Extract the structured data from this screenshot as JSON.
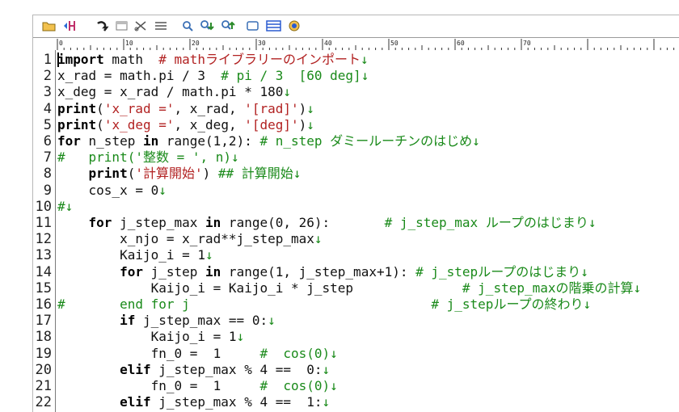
{
  "toolbar": {
    "icons": [
      "open-folder-icon",
      "bookmark-icon",
      "wrap-icon",
      "window-icon",
      "cut-icon",
      "list-icon",
      "search-icon",
      "search-next-icon",
      "search-prev-icon",
      "box-icon",
      "grid-icon",
      "help-icon"
    ]
  },
  "ruler": {
    "marks": [
      "0",
      "10",
      "20",
      "30",
      "40",
      "50",
      "60",
      "70"
    ]
  },
  "lines": [
    {
      "n": "1",
      "segs": [
        {
          "t": "import",
          "c": "kw"
        },
        {
          "t": " math  "
        },
        {
          "t": "# mathライブラリーのインポート",
          "c": "str"
        },
        {
          "t": "↓",
          "c": "eol"
        }
      ]
    },
    {
      "n": "2",
      "segs": [
        {
          "t": "x_rad = math.pi / 3  "
        },
        {
          "t": "# pi / 3  [60 deg]",
          "c": "cm"
        },
        {
          "t": "↓",
          "c": "eol"
        }
      ]
    },
    {
      "n": "3",
      "segs": [
        {
          "t": "x_deg = x_rad / math.pi * 180"
        },
        {
          "t": "↓",
          "c": "eol"
        }
      ]
    },
    {
      "n": "4",
      "segs": [
        {
          "t": "print",
          "c": "kw"
        },
        {
          "t": "("
        },
        {
          "t": "'x_rad ='",
          "c": "str"
        },
        {
          "t": ", x_rad, "
        },
        {
          "t": "'[rad]'",
          "c": "str"
        },
        {
          "t": ")"
        },
        {
          "t": "↓",
          "c": "eol"
        }
      ]
    },
    {
      "n": "5",
      "segs": [
        {
          "t": "print",
          "c": "kw"
        },
        {
          "t": "("
        },
        {
          "t": "'x_deg ='",
          "c": "str"
        },
        {
          "t": ", x_deg, "
        },
        {
          "t": "'[deg]'",
          "c": "str"
        },
        {
          "t": ")"
        },
        {
          "t": "↓",
          "c": "eol"
        }
      ]
    },
    {
      "n": "6",
      "segs": [
        {
          "t": "for",
          "c": "kw"
        },
        {
          "t": " n_step "
        },
        {
          "t": "in",
          "c": "kw"
        },
        {
          "t": " range(1,2): "
        },
        {
          "t": "# n_step ダミールーチンのはじめ",
          "c": "cm"
        },
        {
          "t": "↓",
          "c": "eol"
        }
      ]
    },
    {
      "n": "7",
      "segs": [
        {
          "t": "#   print('整数 = ', n)",
          "c": "cm"
        },
        {
          "t": "↓",
          "c": "eol"
        }
      ]
    },
    {
      "n": "8",
      "segs": [
        {
          "t": "    "
        },
        {
          "t": "print",
          "c": "kw"
        },
        {
          "t": "("
        },
        {
          "t": "'計算開始'",
          "c": "str"
        },
        {
          "t": ") "
        },
        {
          "t": "## 計算開始",
          "c": "cm"
        },
        {
          "t": "↓",
          "c": "eol"
        }
      ]
    },
    {
      "n": "9",
      "segs": [
        {
          "t": "    cos_x = 0"
        },
        {
          "t": "↓",
          "c": "eol"
        }
      ]
    },
    {
      "n": "10",
      "segs": [
        {
          "t": "#",
          "c": "cm"
        },
        {
          "t": "↓",
          "c": "eol"
        }
      ]
    },
    {
      "n": "11",
      "segs": [
        {
          "t": "    "
        },
        {
          "t": "for",
          "c": "kw"
        },
        {
          "t": " j_step_max "
        },
        {
          "t": "in",
          "c": "kw"
        },
        {
          "t": " range(0, 26):       "
        },
        {
          "t": "# j_step_max ループのはじまり",
          "c": "cm"
        },
        {
          "t": "↓",
          "c": "eol"
        }
      ]
    },
    {
      "n": "12",
      "segs": [
        {
          "t": "        x_njo = x_rad**j_step_max"
        },
        {
          "t": "↓",
          "c": "eol"
        }
      ]
    },
    {
      "n": "13",
      "segs": [
        {
          "t": "        Kaijo_i = 1"
        },
        {
          "t": "↓",
          "c": "eol"
        }
      ]
    },
    {
      "n": "14",
      "segs": [
        {
          "t": "        "
        },
        {
          "t": "for",
          "c": "kw"
        },
        {
          "t": " j_step "
        },
        {
          "t": "in",
          "c": "kw"
        },
        {
          "t": " range(1, j_step_max+1): "
        },
        {
          "t": "# j_stepループのはじまり",
          "c": "cm"
        },
        {
          "t": "↓",
          "c": "eol"
        }
      ]
    },
    {
      "n": "15",
      "segs": [
        {
          "t": "            Kaijo_i = Kaijo_i * j_step              "
        },
        {
          "t": "# j_step_maxの階乗の計算",
          "c": "cm"
        },
        {
          "t": "↓",
          "c": "eol"
        }
      ]
    },
    {
      "n": "16",
      "segs": [
        {
          "t": "#       end for j                               ",
          "c": "cm"
        },
        {
          "t": "# j_stepループの終わり",
          "c": "cm"
        },
        {
          "t": "↓",
          "c": "eol"
        }
      ]
    },
    {
      "n": "17",
      "segs": [
        {
          "t": "        "
        },
        {
          "t": "if",
          "c": "kw"
        },
        {
          "t": " j_step_max == 0:"
        },
        {
          "t": "↓",
          "c": "eol"
        }
      ]
    },
    {
      "n": "18",
      "segs": [
        {
          "t": "            Kaijo_i = 1"
        },
        {
          "t": "↓",
          "c": "eol"
        }
      ]
    },
    {
      "n": "19",
      "segs": [
        {
          "t": "            fn_0 =  1     "
        },
        {
          "t": "#  cos(0)",
          "c": "cm"
        },
        {
          "t": "↓",
          "c": "eol"
        }
      ]
    },
    {
      "n": "20",
      "segs": [
        {
          "t": "        "
        },
        {
          "t": "elif",
          "c": "kw"
        },
        {
          "t": " j_step_max % 4 ==  0:"
        },
        {
          "t": "↓",
          "c": "eol"
        }
      ]
    },
    {
      "n": "21",
      "segs": [
        {
          "t": "            fn_0 =  1     "
        },
        {
          "t": "#  cos(0)",
          "c": "cm"
        },
        {
          "t": "↓",
          "c": "eol"
        }
      ]
    },
    {
      "n": "22",
      "segs": [
        {
          "t": "        "
        },
        {
          "t": "elif",
          "c": "kw"
        },
        {
          "t": " j_step_max % 4 ==  1:"
        },
        {
          "t": "↓",
          "c": "eol"
        }
      ]
    }
  ]
}
